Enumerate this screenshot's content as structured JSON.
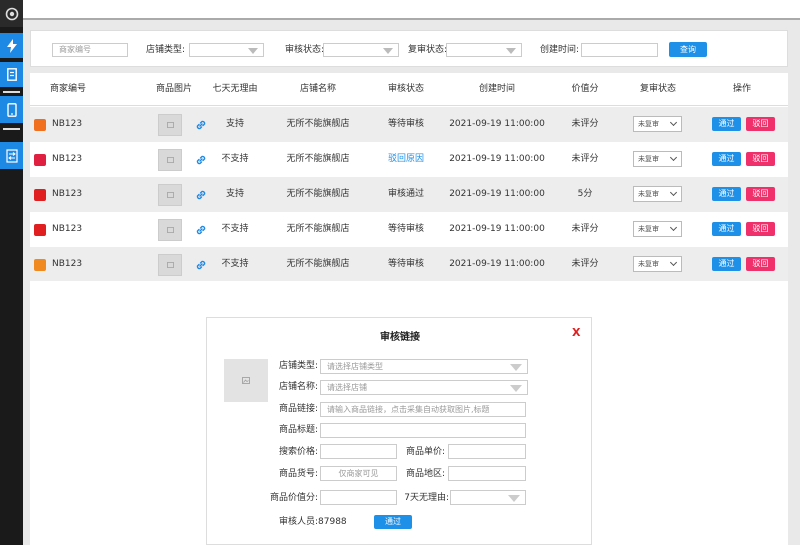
{
  "filter": {
    "merchant_placeholder": "商家编号",
    "store_type_label": "店铺类型:",
    "audit_status_label": "审核状态:",
    "recheck_status_label": "复审状态:",
    "created_time_label": "创建时间:",
    "search_button": "查询"
  },
  "table": {
    "headers": [
      "商家编号",
      "商品图片",
      "七天无理由",
      "店铺名称",
      "审核状态",
      "创建时间",
      "价值分",
      "复审状态",
      "操作"
    ],
    "rows": [
      {
        "merchant": "NB123",
        "seven_day": "支持",
        "store": "无所不能旗舰店",
        "status": "等待审核",
        "status_color": "#333333",
        "created": "2021-09-19 11:00:00",
        "score": "未评分",
        "recheck": "未复审",
        "approve": "通过",
        "reject": "驳回",
        "icon_color": "#f07020"
      },
      {
        "merchant": "NB123",
        "seven_day": "不支持",
        "store": "无所不能旗舰店",
        "status": "驳回原因",
        "status_color": "#1e90e8",
        "created": "2021-09-19 11:00:00",
        "score": "未评分",
        "recheck": "未复审",
        "approve": "通过",
        "reject": "驳回",
        "icon_color": "#e02040"
      },
      {
        "merchant": "NB123",
        "seven_day": "支持",
        "store": "无所不能旗舰店",
        "status": "审核通过",
        "status_color": "#333333",
        "created": "2021-09-19 11:00:00",
        "score": "5分",
        "recheck": "未复审",
        "approve": "通过",
        "reject": "驳回",
        "icon_color": "#e02020"
      },
      {
        "merchant": "NB123",
        "seven_day": "不支持",
        "store": "无所不能旗舰店",
        "status": "等待审核",
        "status_color": "#333333",
        "created": "2021-09-19 11:00:00",
        "score": "未评分",
        "recheck": "未复审",
        "approve": "通过",
        "reject": "驳回",
        "icon_color": "#e02020"
      },
      {
        "merchant": "NB123",
        "seven_day": "不支持",
        "store": "无所不能旗舰店",
        "status": "等待审核",
        "status_color": "#333333",
        "created": "2021-09-19 11:00:00",
        "score": "未评分",
        "recheck": "未复审",
        "approve": "通过",
        "reject": "驳回",
        "icon_color": "#f08a20"
      }
    ]
  },
  "modal": {
    "title": "审核链接",
    "close": "X",
    "store_type_label": "店铺类型:",
    "store_type_placeholder": "请选择店铺类型",
    "store_name_label": "店铺名称:",
    "store_name_placeholder": "请选择店铺",
    "product_link_label": "商品链接:",
    "product_link_placeholder": "请输入商品链接，点击采集自动获取图片,标题",
    "product_title_label": "商品标题:",
    "search_price_label": "搜索价格:",
    "unit_price_label": "商品单价:",
    "sku_label": "商品货号:",
    "sku_placeholder": "仅商家可见",
    "region_label": "商品地区:",
    "value_score_label": "商品价值分:",
    "seven_day_label": "7天无理由:",
    "auditor_label": "审核人员:87988",
    "approve_button": "通过"
  }
}
